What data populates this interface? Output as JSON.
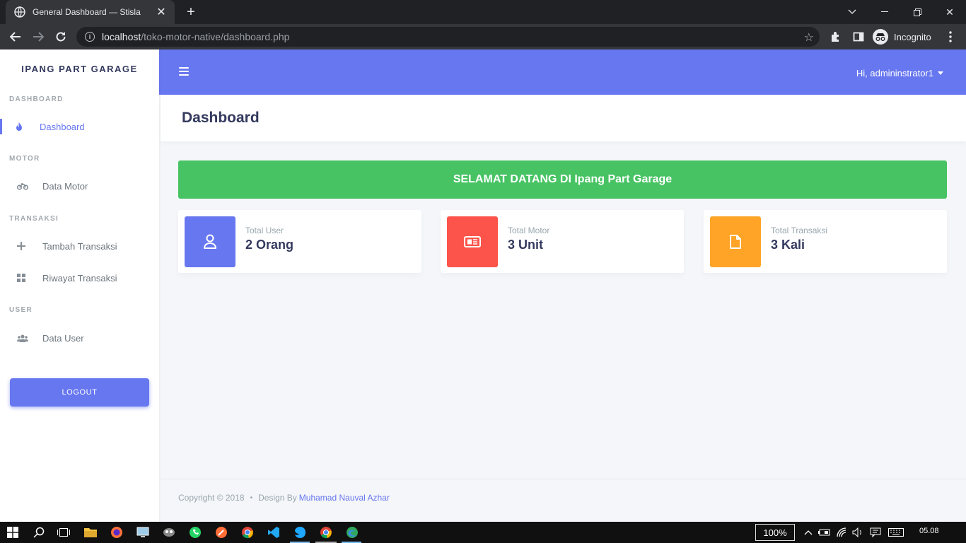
{
  "browser": {
    "tab_title": "General Dashboard — Stisla",
    "url_host": "localhost",
    "url_path": "/toko-motor-native/dashboard.php",
    "profile_label": "Incognito"
  },
  "sidebar": {
    "brand": "IPANG PART GARAGE",
    "sections": [
      {
        "header": "DASHBOARD",
        "items": [
          {
            "label": "Dashboard",
            "icon": "fire-icon",
            "active": true
          }
        ]
      },
      {
        "header": "MOTOR",
        "items": [
          {
            "label": "Data Motor",
            "icon": "motorcycle-icon"
          }
        ]
      },
      {
        "header": "TRANSAKSI",
        "items": [
          {
            "label": "Tambah Transaksi",
            "icon": "plus-icon"
          },
          {
            "label": "Riwayat Transaksi",
            "icon": "grid-icon"
          }
        ]
      },
      {
        "header": "USER",
        "items": [
          {
            "label": "Data User",
            "icon": "users-icon"
          }
        ]
      }
    ],
    "logout_label": "LOGOUT"
  },
  "navbar": {
    "greeting": "Hi, admininstrator1"
  },
  "page": {
    "title": "Dashboard",
    "welcome": "SELAMAT DATANG DI Ipang Part Garage"
  },
  "stats": [
    {
      "label": "Total User",
      "value": "2 Orang",
      "color": "#6777ef",
      "icon": "user-icon"
    },
    {
      "label": "Total Motor",
      "value": "3 Unit",
      "color": "#fc544b",
      "icon": "newspaper-icon"
    },
    {
      "label": "Total Transaksi",
      "value": "3 Kali",
      "color": "#ffa426",
      "icon": "file-icon"
    }
  ],
  "footer": {
    "copyright": "Copyright © 2018",
    "design_by": "Design By",
    "author": "Muhamad Nauval Azhar"
  },
  "taskbar": {
    "zoom": "100%",
    "time": "05.08"
  },
  "colors": {
    "primary": "#6777ef",
    "success": "#47c363",
    "danger": "#fc544b",
    "warning": "#ffa426"
  }
}
